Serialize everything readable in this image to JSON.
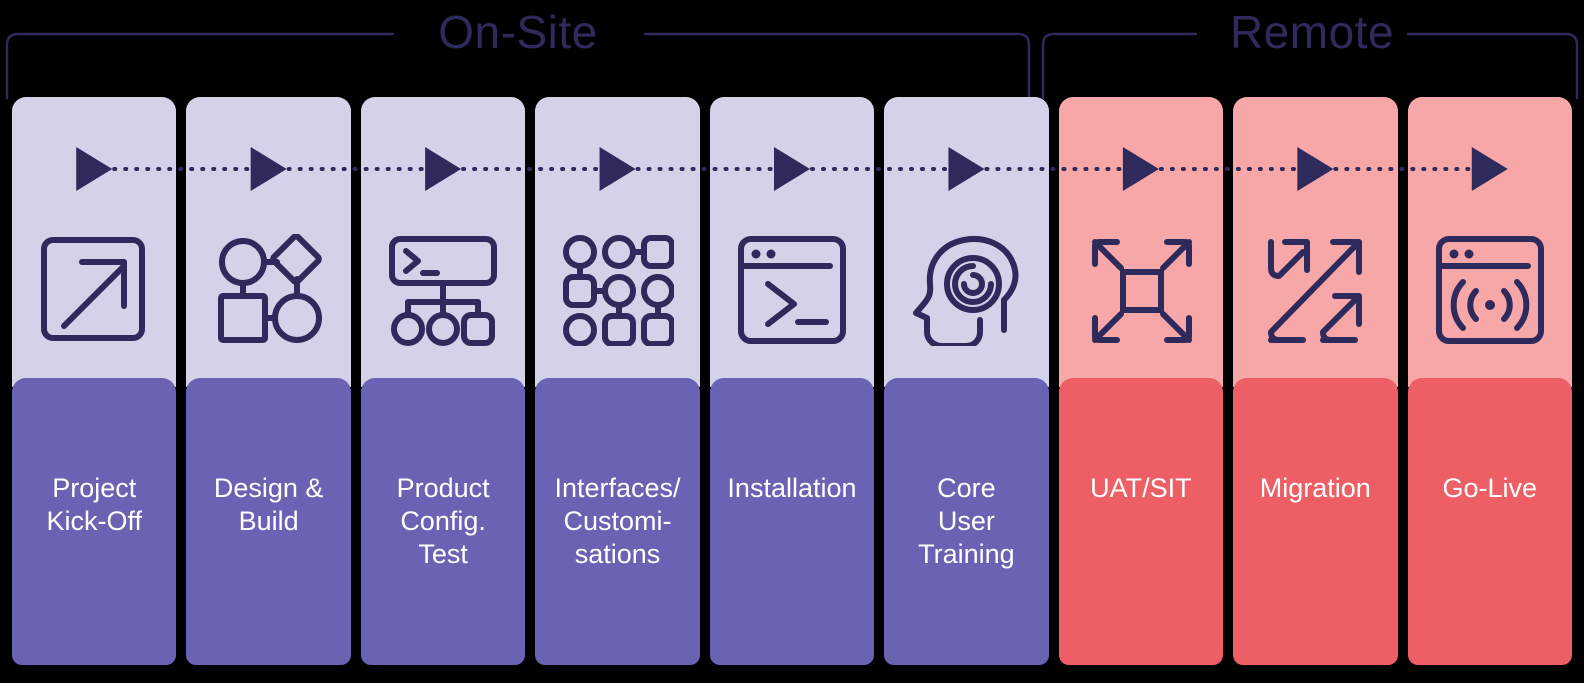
{
  "diagram": {
    "title_groups": [
      {
        "id": "on-site",
        "label": "On-Site",
        "span": 6
      },
      {
        "id": "remote",
        "label": "Remote",
        "span": 3
      }
    ],
    "colors": {
      "background": "#000000",
      "stroke": "#2e2a5c",
      "onsite_top": "#d3d2e8",
      "onsite_bottom": "#6a63b4",
      "remote_top": "#f7a7a8",
      "remote_bottom": "#ed5f65",
      "label_text": "#ffffff"
    },
    "steps": [
      {
        "id": "project-kick-off",
        "label": "Project\nKick-Off",
        "group": "on-site",
        "icon": "square-diagonal-arrow-icon"
      },
      {
        "id": "design-build",
        "label": "Design &\nBuild",
        "group": "on-site",
        "icon": "node-network-shapes-icon"
      },
      {
        "id": "product-config-test",
        "label": "Product\nConfig.\nTest",
        "group": "on-site",
        "icon": "terminal-hierarchy-icon"
      },
      {
        "id": "interfaces-customisations",
        "label": "Interfaces/\nCustomi-\nsations",
        "group": "on-site",
        "icon": "node-grid-icon"
      },
      {
        "id": "installation",
        "label": "Installation",
        "group": "on-site",
        "icon": "terminal-window-icon"
      },
      {
        "id": "core-user-training",
        "label": "Core\nUser\nTraining",
        "group": "on-site",
        "icon": "head-brain-icon"
      },
      {
        "id": "uat-sit",
        "label": "UAT/SIT",
        "group": "remote",
        "icon": "expand-arrows-square-icon"
      },
      {
        "id": "migration",
        "label": "Migration",
        "group": "remote",
        "icon": "migration-arrows-icon"
      },
      {
        "id": "go-live",
        "label": "Go-Live",
        "group": "remote",
        "icon": "broadcast-window-icon"
      }
    ],
    "connector": {
      "style": "dotted",
      "marker": "triangle-right-arrow-icon",
      "count": 9
    }
  }
}
